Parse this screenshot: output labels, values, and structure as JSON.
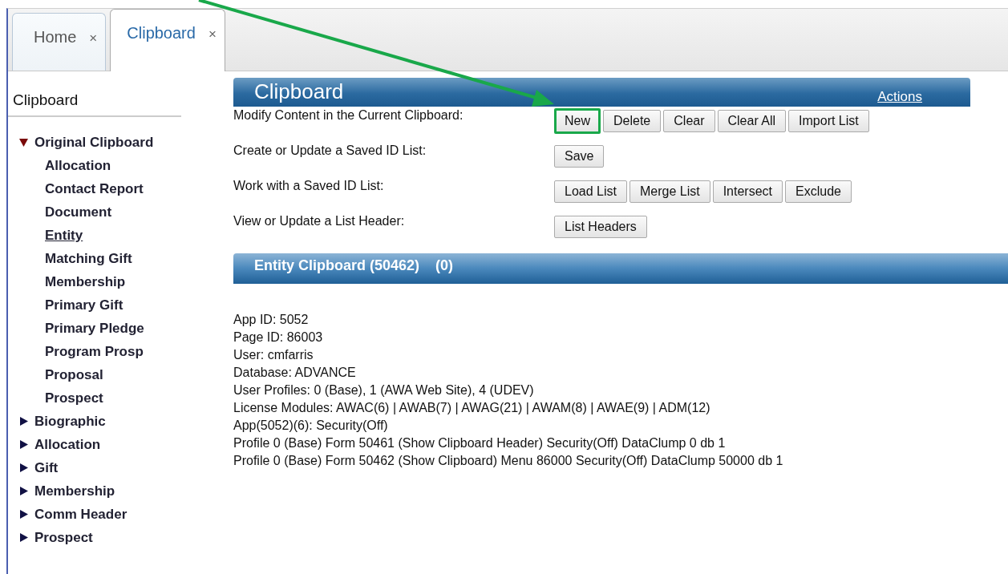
{
  "tabs": [
    {
      "label": "Home",
      "close": "×",
      "selected": false
    },
    {
      "label": "Clipboard",
      "close": "×",
      "selected": true
    }
  ],
  "sidebar": {
    "title": "Clipboard",
    "tree": [
      {
        "label": "Original Clipboard",
        "expanded": true,
        "children": [
          {
            "label": "Allocation",
            "selected": false
          },
          {
            "label": "Contact Report",
            "selected": false
          },
          {
            "label": "Document",
            "selected": false
          },
          {
            "label": "Entity",
            "selected": true
          },
          {
            "label": "Matching Gift",
            "selected": false
          },
          {
            "label": "Membership",
            "selected": false
          },
          {
            "label": "Primary Gift",
            "selected": false
          },
          {
            "label": "Primary Pledge",
            "selected": false
          },
          {
            "label": "Program Prosp",
            "selected": false
          },
          {
            "label": "Proposal",
            "selected": false
          },
          {
            "label": "Prospect",
            "selected": false
          }
        ]
      },
      {
        "label": "Biographic",
        "expanded": false
      },
      {
        "label": "Allocation",
        "expanded": false
      },
      {
        "label": "Gift",
        "expanded": false
      },
      {
        "label": "Membership",
        "expanded": false
      },
      {
        "label": "Comm Header",
        "expanded": false
      },
      {
        "label": "Prospect",
        "expanded": false
      }
    ]
  },
  "panel": {
    "title": "Clipboard",
    "actions": "Actions",
    "rows": [
      {
        "label": "Modify Content in the Current Clipboard:",
        "buttons": [
          {
            "label": "New",
            "highlighted": true
          },
          {
            "label": "Delete",
            "highlighted": false
          },
          {
            "label": "Clear",
            "highlighted": false
          },
          {
            "label": "Clear All",
            "highlighted": false
          },
          {
            "label": "Import List",
            "highlighted": false
          }
        ]
      },
      {
        "label": "Create or Update a Saved ID List:",
        "buttons": [
          {
            "label": "Save",
            "highlighted": false
          }
        ]
      },
      {
        "label": "Work with a Saved ID List:",
        "buttons": [
          {
            "label": "Load List",
            "highlighted": false
          },
          {
            "label": "Merge List",
            "highlighted": false
          },
          {
            "label": "Intersect",
            "highlighted": false
          },
          {
            "label": "Exclude",
            "highlighted": false
          }
        ]
      },
      {
        "label": "View or Update a List Header:",
        "buttons": [
          {
            "label": "List Headers",
            "highlighted": false
          }
        ]
      }
    ]
  },
  "entity_bar": {
    "title": "Entity Clipboard (50462)",
    "count": "(0)"
  },
  "info_lines": [
    "App ID: 5052",
    "Page ID: 86003",
    "User: cmfarris",
    "Database: ADVANCE",
    "User Profiles: 0 (Base), 1 (AWA Web Site), 4 (UDEV)",
    "License Modules: AWAC(6) | AWAB(7) | AWAG(21) | AWAM(8) | AWAE(9) | ADM(12)",
    "App(5052)(6): Security(Off)",
    "Profile 0 (Base) Form 50461 (Show Clipboard Header) Security(Off) DataClump 0 db 1",
    "Profile 0 (Base) Form 50462 (Show Clipboard) Menu 86000 Security(Off) DataClump 50000 db 1"
  ]
}
